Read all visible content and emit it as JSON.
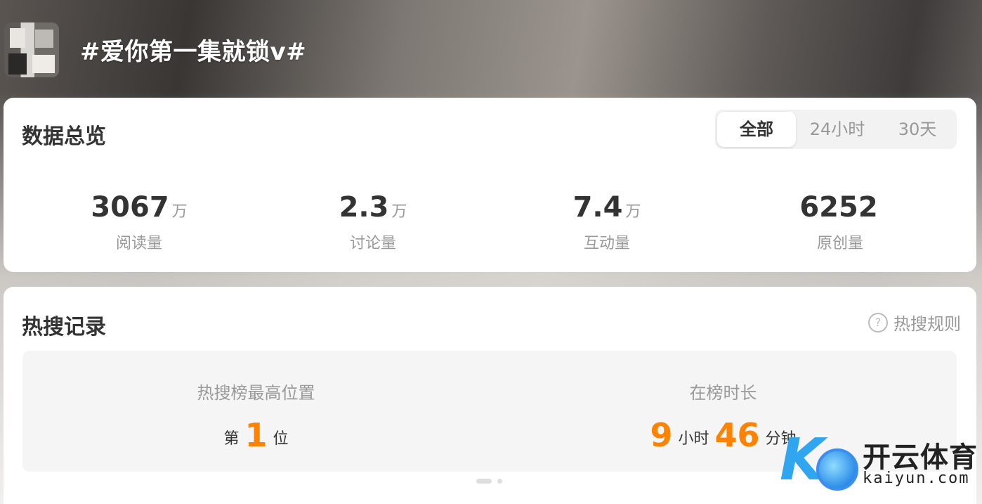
{
  "topic": {
    "title": "#爱你第一集就锁v#"
  },
  "overview": {
    "title": "数据总览",
    "tabs": [
      {
        "label": "全部",
        "active": true
      },
      {
        "label": "24小时",
        "active": false
      },
      {
        "label": "30天",
        "active": false
      }
    ],
    "stats": [
      {
        "value": "3067",
        "unit": "万",
        "label": "阅读量"
      },
      {
        "value": "2.3",
        "unit": "万",
        "label": "讨论量"
      },
      {
        "value": "7.4",
        "unit": "万",
        "label": "互动量"
      },
      {
        "value": "6252",
        "unit": "",
        "label": "原创量"
      }
    ]
  },
  "hot_search": {
    "title": "热搜记录",
    "rules_label": "热搜规则",
    "rules_icon": "?",
    "best_position": {
      "label": "热搜榜最高位置",
      "prefix": "第",
      "value": "1",
      "suffix": "位"
    },
    "duration": {
      "label": "在榜时长",
      "hours": "9",
      "hours_unit": "小时",
      "minutes": "46",
      "minutes_unit": "分钟"
    }
  },
  "watermark": {
    "brand_cn": "开云体育",
    "brand_en": "kaiyun.com",
    "logo_letter": "K"
  },
  "colors": {
    "accent": "#ff8200",
    "text_primary": "#333333",
    "text_secondary": "#999999",
    "card_bg": "#ffffff",
    "panel_bg": "#f5f5f5"
  }
}
